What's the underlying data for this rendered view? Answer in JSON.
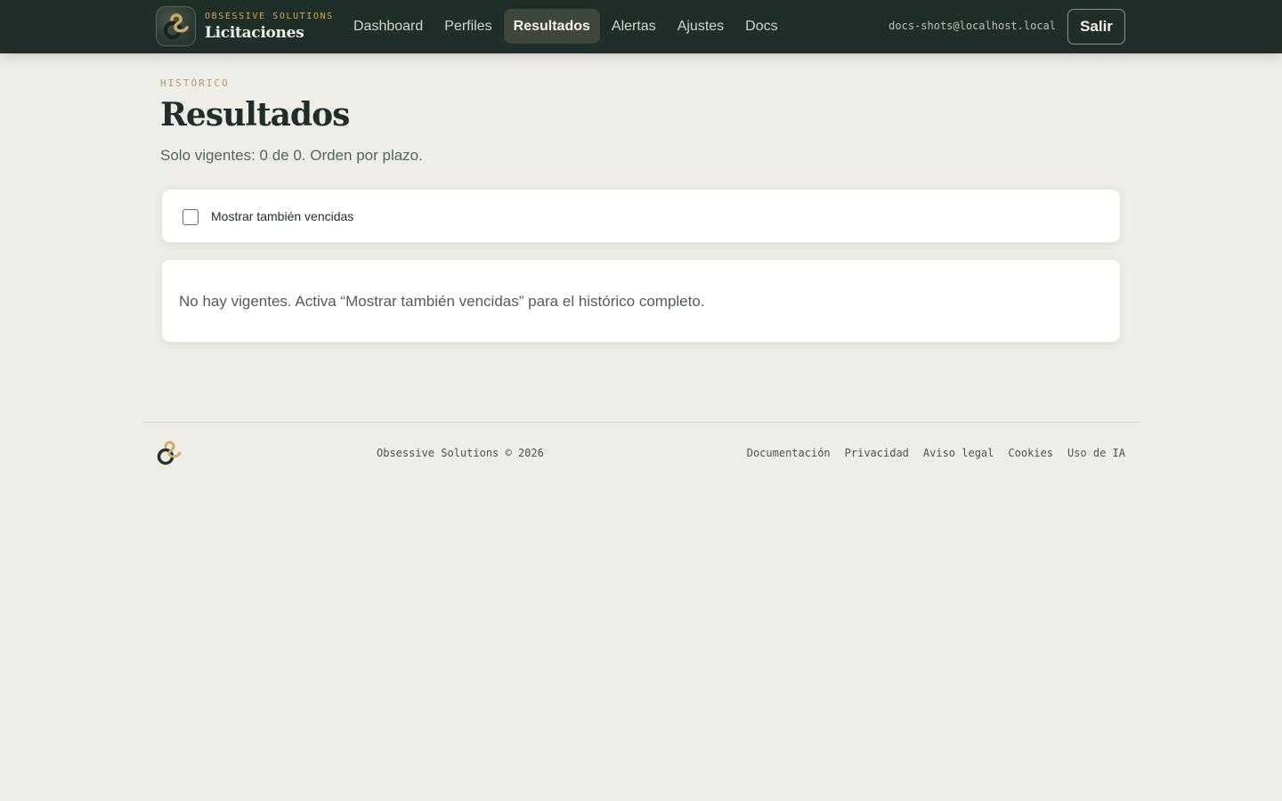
{
  "brand": {
    "company": "OBSESSIVE SOLUTIONS",
    "product": "Licitaciones"
  },
  "nav": {
    "items": [
      {
        "label": "Dashboard",
        "active": false
      },
      {
        "label": "Perfiles",
        "active": false
      },
      {
        "label": "Resultados",
        "active": true
      },
      {
        "label": "Alertas",
        "active": false
      },
      {
        "label": "Ajustes",
        "active": false
      },
      {
        "label": "Docs",
        "active": false
      }
    ]
  },
  "user": {
    "email": "docs-shots@localhost.local",
    "logout_label": "Salir"
  },
  "page": {
    "eyebrow": "HISTÓRICO",
    "title": "Resultados",
    "subtitle": "Solo vigentes: 0 de 0. Orden por plazo."
  },
  "filter": {
    "show_expired_label": "Mostrar también vencidas",
    "checked": false
  },
  "results": {
    "empty_message": "No hay vigentes. Activa “Mostrar también vencidas” para el histórico completo."
  },
  "footer": {
    "copyright": "Obsessive Solutions © 2026",
    "links": [
      "Documentación",
      "Privacidad",
      "Aviso legal",
      "Cookies",
      "Uso de IA"
    ]
  },
  "colors": {
    "topbar": "#1f2e29",
    "accent_gold": "#c9a968",
    "background": "#efede8"
  },
  "icons": {
    "brand_logo": "obsessive-logo-icon",
    "footer_logo": "obsessive-logo-icon"
  }
}
